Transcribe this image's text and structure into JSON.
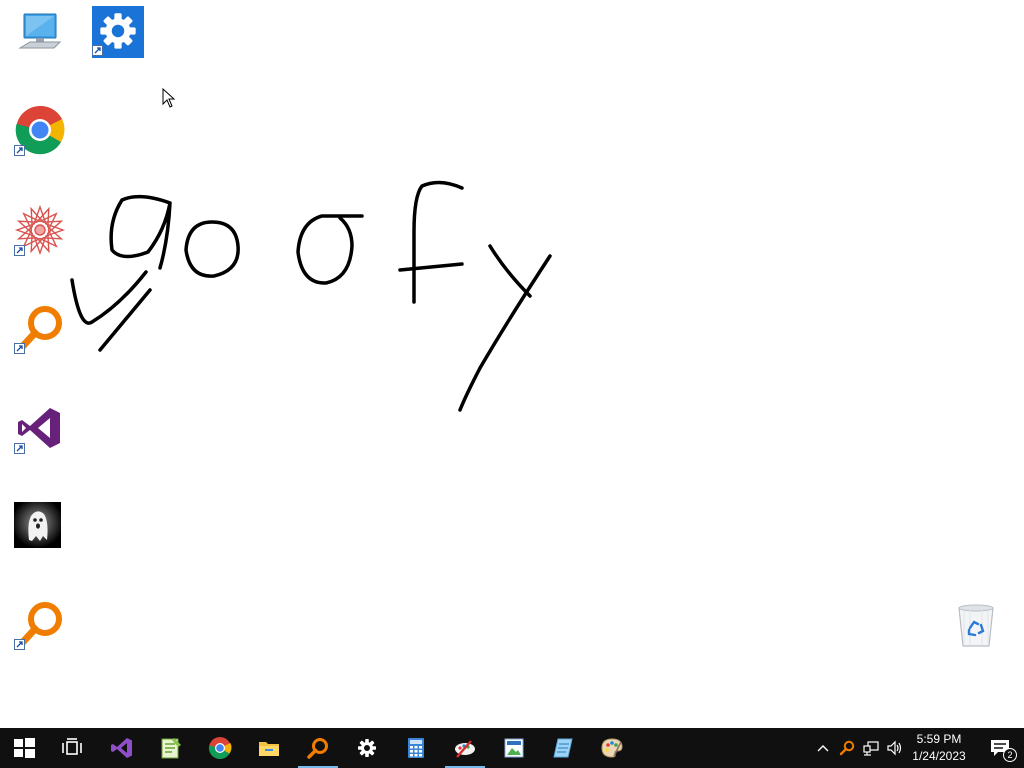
{
  "desktop": {
    "icons": [
      {
        "name": "this-pc-icon",
        "shortcut": false
      },
      {
        "name": "settings-shortcut-icon",
        "shortcut": true
      },
      {
        "name": "chrome-shortcut-icon",
        "shortcut": true
      },
      {
        "name": "mandala-app-shortcut-icon",
        "shortcut": true
      },
      {
        "name": "search-tool-shortcut-icon",
        "shortcut": true
      },
      {
        "name": "visual-studio-shortcut-icon",
        "shortcut": true
      },
      {
        "name": "ghost-app-icon",
        "shortcut": false
      },
      {
        "name": "search-tool-shortcut-2-icon",
        "shortcut": true
      },
      {
        "name": "recycle-bin-icon",
        "shortcut": false
      }
    ],
    "drawing_text": "goofy",
    "ink_color": "#000000"
  },
  "taskbar": {
    "accent": "#76b9ed",
    "apps": [
      {
        "name": "start-button"
      },
      {
        "name": "task-view-button"
      },
      {
        "name": "visual-studio-taskbar"
      },
      {
        "name": "notepad-taskbar"
      },
      {
        "name": "chrome-taskbar"
      },
      {
        "name": "file-explorer-taskbar"
      },
      {
        "name": "search-tool-taskbar",
        "active": true
      },
      {
        "name": "settings-taskbar"
      },
      {
        "name": "calculator-taskbar"
      },
      {
        "name": "paint-app-taskbar",
        "active": true
      },
      {
        "name": "image-viewer-taskbar"
      },
      {
        "name": "notes-taskbar"
      },
      {
        "name": "paint-palette-taskbar"
      }
    ],
    "clock": {
      "time": "5:59 PM",
      "date": "1/24/2023"
    },
    "notifications": {
      "count": "2"
    }
  }
}
